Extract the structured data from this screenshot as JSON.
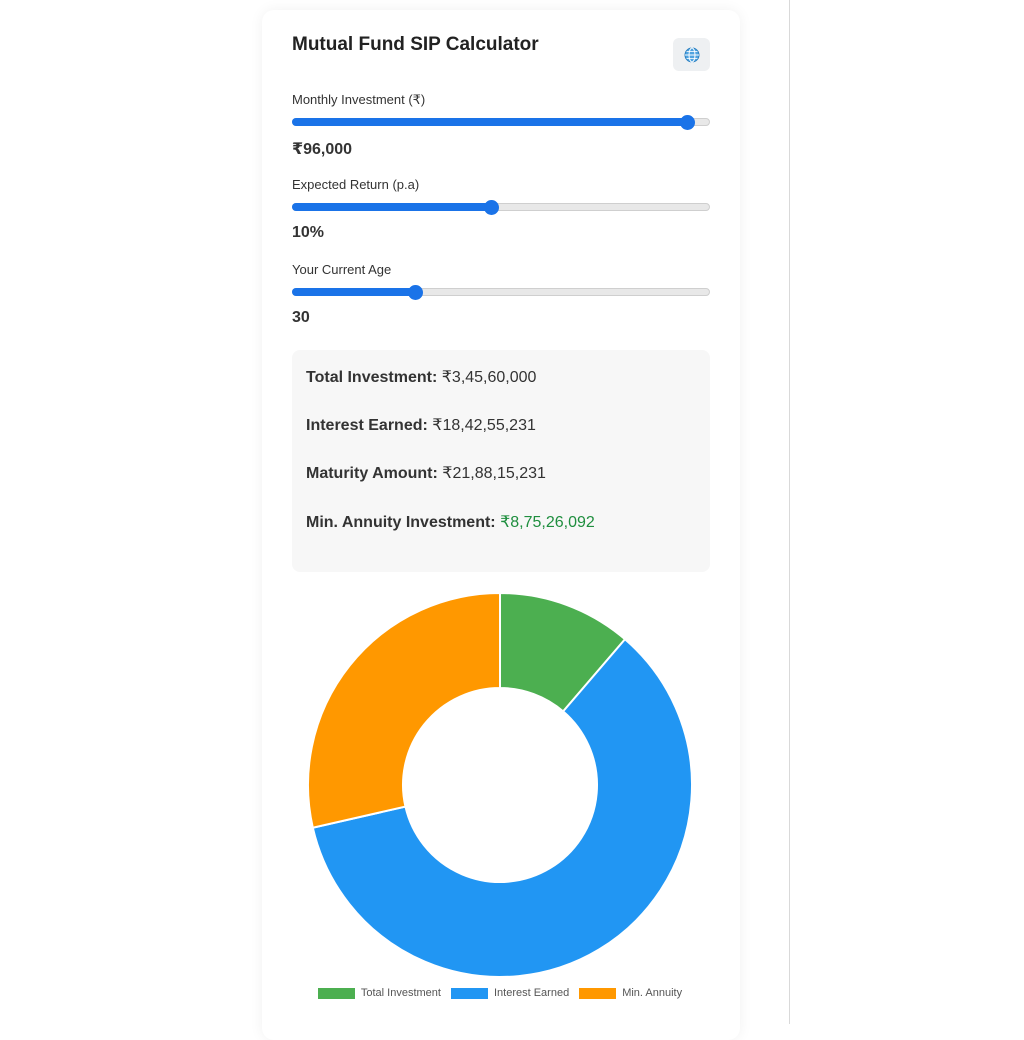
{
  "header": {
    "title": "Mutual Fund SIP Calculator",
    "language_icon": "globe-icon"
  },
  "inputs": {
    "monthly_investment": {
      "label": "Monthly Investment (₹)",
      "value_text": "₹96,000",
      "slider_fraction": 0.945
    },
    "expected_return": {
      "label": "Expected Return (p.a)",
      "value_text": "10%",
      "slider_fraction": 0.475
    },
    "current_age": {
      "label": "Your Current Age",
      "value_text": "30",
      "slider_fraction": 0.295
    }
  },
  "results": {
    "total_investment": {
      "label": "Total Investment:",
      "value": "₹3,45,60,000"
    },
    "interest_earned": {
      "label": "Interest Earned:",
      "value": "₹18,42,55,231"
    },
    "maturity_amount": {
      "label": "Maturity Amount:",
      "value": "₹21,88,15,231"
    },
    "min_annuity": {
      "label": "Min. Annuity Investment:",
      "value": "₹8,75,26,092"
    }
  },
  "colors": {
    "accent": "#1a73e8",
    "positive": "#1e8e3e"
  },
  "chart_data": {
    "type": "pie",
    "variant": "doughnut",
    "categories": [
      "Total Investment",
      "Interest Earned",
      "Min. Annuity"
    ],
    "values": [
      34560000,
      184255231,
      87526092
    ],
    "colors": [
      "#4caf50",
      "#2196f3",
      "#ff9800"
    ],
    "legend_position": "bottom"
  }
}
